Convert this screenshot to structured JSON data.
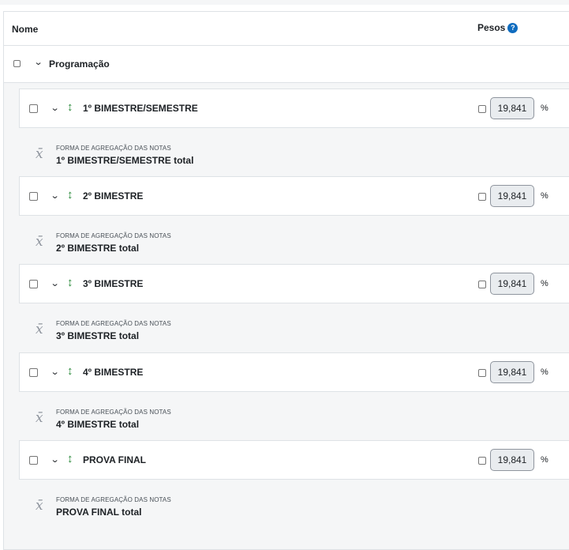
{
  "header": {
    "name_label": "Nome",
    "weights_label": "Pesos",
    "help_glyph": "?"
  },
  "category": {
    "title": "Programação"
  },
  "icons": {
    "chevron": "⌄",
    "move": "↕",
    "mean": "x̄"
  },
  "items": [
    {
      "title": "1º BIMESTRE/SEMESTRE",
      "weight": "19,841",
      "unit": "%",
      "agg_label": "FORMA DE AGREGAÇÃO DAS NOTAS",
      "agg_title": "1º BIMESTRE/SEMESTRE total"
    },
    {
      "title": "2º BIMESTRE",
      "weight": "19,841",
      "unit": "%",
      "agg_label": "FORMA DE AGREGAÇÃO DAS NOTAS",
      "agg_title": "2º BIMESTRE total"
    },
    {
      "title": "3º BIMESTRE",
      "weight": "19,841",
      "unit": "%",
      "agg_label": "FORMA DE AGREGAÇÃO DAS NOTAS",
      "agg_title": "3º BIMESTRE total"
    },
    {
      "title": "4º BIMESTRE",
      "weight": "19,841",
      "unit": "%",
      "agg_label": "FORMA DE AGREGAÇÃO DAS NOTAS",
      "agg_title": "4º BIMESTRE total"
    },
    {
      "title": "PROVA FINAL",
      "weight": "19,841",
      "unit": "%",
      "agg_label": "FORMA DE AGREGAÇÃO DAS NOTAS",
      "agg_title": "PROVA FINAL total"
    }
  ]
}
